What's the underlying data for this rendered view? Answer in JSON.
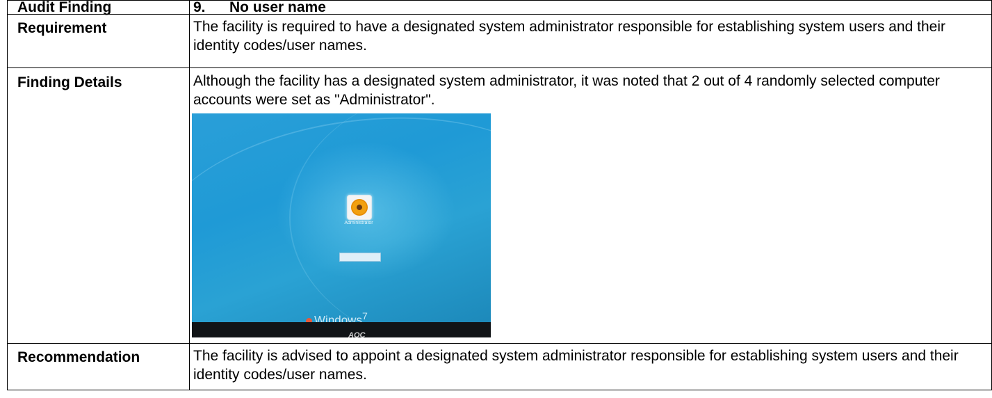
{
  "audit": {
    "header_label": "Audit Finding",
    "finding_number": "9.",
    "finding_title": "No user name"
  },
  "requirement": {
    "label": "Requirement",
    "text": "The facility is required to have a designated system administrator responsible for establishing system users and their identity codes/user names."
  },
  "finding_details": {
    "label": "Finding Details",
    "text": "Although the facility has a designated system administrator, it was noted that 2 out of 4 randomly selected computer accounts were set as  \"Administrator\".",
    "screenshot": {
      "user_label": "Administrator",
      "os_text": "Windows",
      "os_version": "7",
      "monitor_brand": "AOC"
    }
  },
  "recommendation": {
    "label": "Recommendation",
    "text": "The facility is advised to appoint a designated system administrator responsible for establishing system users and their identity codes/user names."
  }
}
